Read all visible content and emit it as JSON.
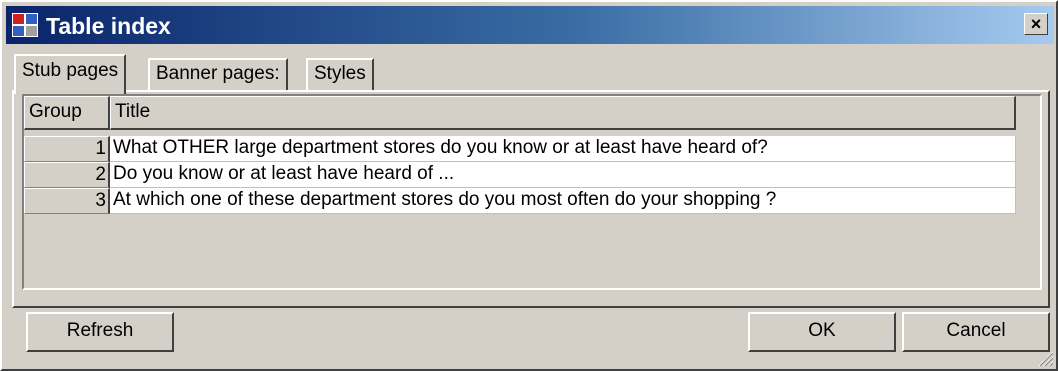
{
  "window": {
    "title": "Table index",
    "close_glyph": "×"
  },
  "tabs": [
    {
      "label": "Stub pages",
      "active": true
    },
    {
      "label": "Banner pages:",
      "active": false
    },
    {
      "label": "Styles",
      "active": false
    }
  ],
  "grid": {
    "columns": [
      "Group",
      "Title"
    ],
    "rows": [
      {
        "group": "1",
        "title": "What OTHER large department stores do you know or at least have heard of?"
      },
      {
        "group": "2",
        "title": "Do you know or at least have heard of ..."
      },
      {
        "group": "3",
        "title": "At which one of these department stores do you most often do your shopping ?"
      }
    ]
  },
  "buttons": {
    "refresh": "Refresh",
    "ok": "OK",
    "cancel": "Cancel"
  },
  "colors": {
    "titlebar_start": "#0a246a",
    "titlebar_end": "#a6caf0",
    "face": "#d4d0c8"
  },
  "icons": {
    "app": "table-app-icon",
    "close": "close-icon",
    "grip": "resize-grip-icon"
  }
}
